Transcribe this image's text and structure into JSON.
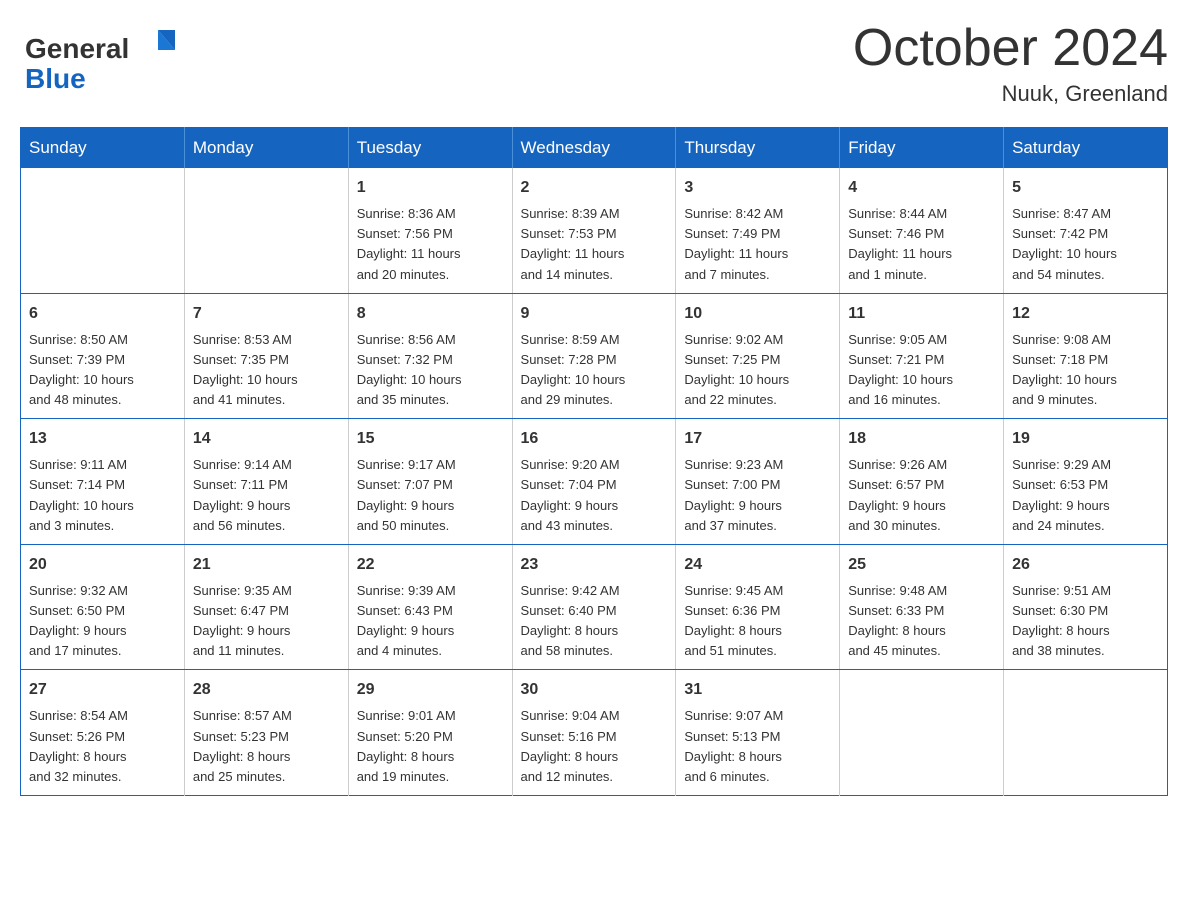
{
  "header": {
    "title": "October 2024",
    "location": "Nuuk, Greenland",
    "logo_general": "General",
    "logo_blue": "Blue"
  },
  "weekdays": [
    "Sunday",
    "Monday",
    "Tuesday",
    "Wednesday",
    "Thursday",
    "Friday",
    "Saturday"
  ],
  "weeks": [
    [
      {
        "day": "",
        "info": ""
      },
      {
        "day": "",
        "info": ""
      },
      {
        "day": "1",
        "info": "Sunrise: 8:36 AM\nSunset: 7:56 PM\nDaylight: 11 hours\nand 20 minutes."
      },
      {
        "day": "2",
        "info": "Sunrise: 8:39 AM\nSunset: 7:53 PM\nDaylight: 11 hours\nand 14 minutes."
      },
      {
        "day": "3",
        "info": "Sunrise: 8:42 AM\nSunset: 7:49 PM\nDaylight: 11 hours\nand 7 minutes."
      },
      {
        "day": "4",
        "info": "Sunrise: 8:44 AM\nSunset: 7:46 PM\nDaylight: 11 hours\nand 1 minute."
      },
      {
        "day": "5",
        "info": "Sunrise: 8:47 AM\nSunset: 7:42 PM\nDaylight: 10 hours\nand 54 minutes."
      }
    ],
    [
      {
        "day": "6",
        "info": "Sunrise: 8:50 AM\nSunset: 7:39 PM\nDaylight: 10 hours\nand 48 minutes."
      },
      {
        "day": "7",
        "info": "Sunrise: 8:53 AM\nSunset: 7:35 PM\nDaylight: 10 hours\nand 41 minutes."
      },
      {
        "day": "8",
        "info": "Sunrise: 8:56 AM\nSunset: 7:32 PM\nDaylight: 10 hours\nand 35 minutes."
      },
      {
        "day": "9",
        "info": "Sunrise: 8:59 AM\nSunset: 7:28 PM\nDaylight: 10 hours\nand 29 minutes."
      },
      {
        "day": "10",
        "info": "Sunrise: 9:02 AM\nSunset: 7:25 PM\nDaylight: 10 hours\nand 22 minutes."
      },
      {
        "day": "11",
        "info": "Sunrise: 9:05 AM\nSunset: 7:21 PM\nDaylight: 10 hours\nand 16 minutes."
      },
      {
        "day": "12",
        "info": "Sunrise: 9:08 AM\nSunset: 7:18 PM\nDaylight: 10 hours\nand 9 minutes."
      }
    ],
    [
      {
        "day": "13",
        "info": "Sunrise: 9:11 AM\nSunset: 7:14 PM\nDaylight: 10 hours\nand 3 minutes."
      },
      {
        "day": "14",
        "info": "Sunrise: 9:14 AM\nSunset: 7:11 PM\nDaylight: 9 hours\nand 56 minutes."
      },
      {
        "day": "15",
        "info": "Sunrise: 9:17 AM\nSunset: 7:07 PM\nDaylight: 9 hours\nand 50 minutes."
      },
      {
        "day": "16",
        "info": "Sunrise: 9:20 AM\nSunset: 7:04 PM\nDaylight: 9 hours\nand 43 minutes."
      },
      {
        "day": "17",
        "info": "Sunrise: 9:23 AM\nSunset: 7:00 PM\nDaylight: 9 hours\nand 37 minutes."
      },
      {
        "day": "18",
        "info": "Sunrise: 9:26 AM\nSunset: 6:57 PM\nDaylight: 9 hours\nand 30 minutes."
      },
      {
        "day": "19",
        "info": "Sunrise: 9:29 AM\nSunset: 6:53 PM\nDaylight: 9 hours\nand 24 minutes."
      }
    ],
    [
      {
        "day": "20",
        "info": "Sunrise: 9:32 AM\nSunset: 6:50 PM\nDaylight: 9 hours\nand 17 minutes."
      },
      {
        "day": "21",
        "info": "Sunrise: 9:35 AM\nSunset: 6:47 PM\nDaylight: 9 hours\nand 11 minutes."
      },
      {
        "day": "22",
        "info": "Sunrise: 9:39 AM\nSunset: 6:43 PM\nDaylight: 9 hours\nand 4 minutes."
      },
      {
        "day": "23",
        "info": "Sunrise: 9:42 AM\nSunset: 6:40 PM\nDaylight: 8 hours\nand 58 minutes."
      },
      {
        "day": "24",
        "info": "Sunrise: 9:45 AM\nSunset: 6:36 PM\nDaylight: 8 hours\nand 51 minutes."
      },
      {
        "day": "25",
        "info": "Sunrise: 9:48 AM\nSunset: 6:33 PM\nDaylight: 8 hours\nand 45 minutes."
      },
      {
        "day": "26",
        "info": "Sunrise: 9:51 AM\nSunset: 6:30 PM\nDaylight: 8 hours\nand 38 minutes."
      }
    ],
    [
      {
        "day": "27",
        "info": "Sunrise: 8:54 AM\nSunset: 5:26 PM\nDaylight: 8 hours\nand 32 minutes."
      },
      {
        "day": "28",
        "info": "Sunrise: 8:57 AM\nSunset: 5:23 PM\nDaylight: 8 hours\nand 25 minutes."
      },
      {
        "day": "29",
        "info": "Sunrise: 9:01 AM\nSunset: 5:20 PM\nDaylight: 8 hours\nand 19 minutes."
      },
      {
        "day": "30",
        "info": "Sunrise: 9:04 AM\nSunset: 5:16 PM\nDaylight: 8 hours\nand 12 minutes."
      },
      {
        "day": "31",
        "info": "Sunrise: 9:07 AM\nSunset: 5:13 PM\nDaylight: 8 hours\nand 6 minutes."
      },
      {
        "day": "",
        "info": ""
      },
      {
        "day": "",
        "info": ""
      }
    ]
  ]
}
